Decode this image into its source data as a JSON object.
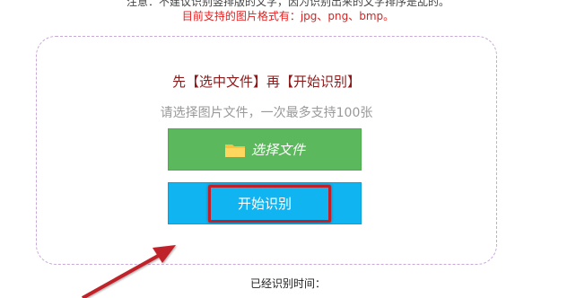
{
  "notice": {
    "top_text": "注意：不建议识别竖排版的文字，因为识别出来的文字排序是乱的。",
    "formats": "目前支持的图片格式有：jpg、png、bmp。"
  },
  "upload": {
    "instruction": "先【选中文件】再【开始识别】",
    "hint": "请选择图片文件，一次最多支持100张",
    "select_label": "选择文件",
    "start_label": "开始识别"
  },
  "status": {
    "elapsed_label": "已经识别时间："
  },
  "icons": {
    "folder": "folder-icon"
  },
  "colors": {
    "select_button": "#5cb85c",
    "start_button": "#10b4f0",
    "annotation": "#c0202a"
  }
}
